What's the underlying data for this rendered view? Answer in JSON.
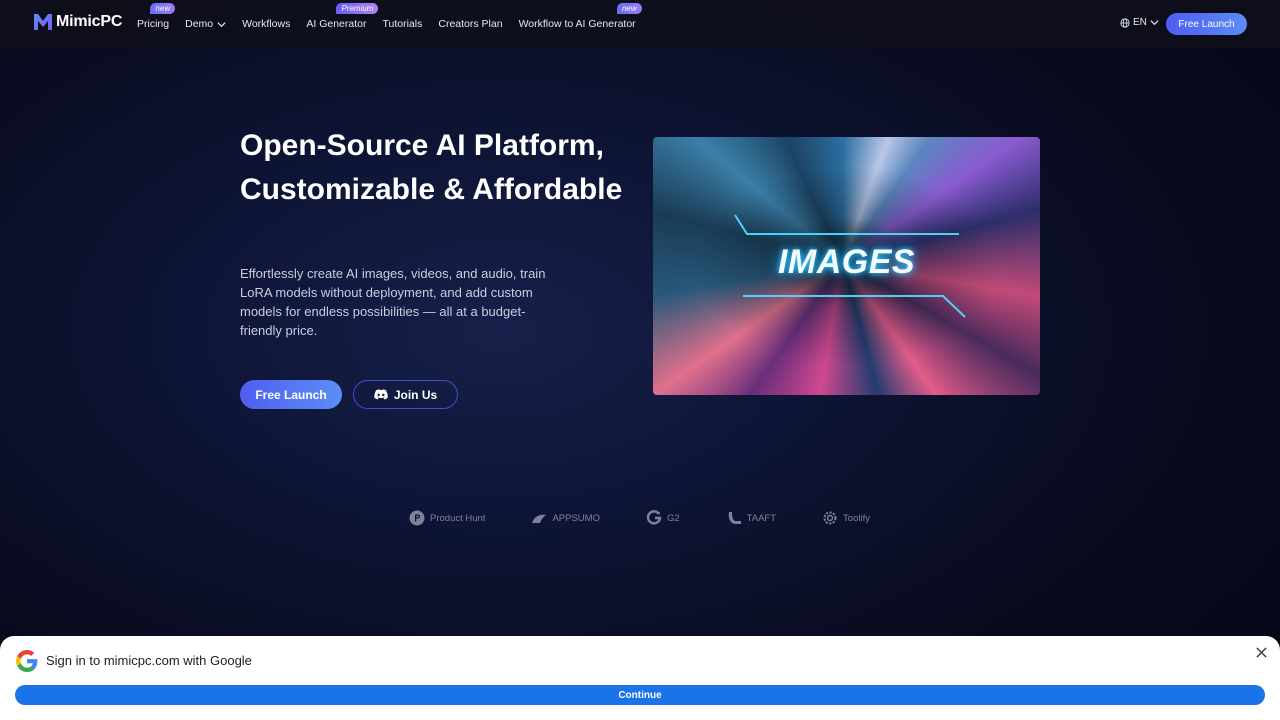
{
  "nav": {
    "logo_text": "MimicPC",
    "items": [
      {
        "label": "Pricing",
        "badge": "new"
      },
      {
        "label": "Demo",
        "badge": ""
      },
      {
        "label": "Workflows",
        "badge": ""
      },
      {
        "label": "AI Generator",
        "badge": "Premium"
      },
      {
        "label": "Tutorials",
        "badge": ""
      },
      {
        "label": "Creators Plan",
        "badge": ""
      },
      {
        "label": "Workflow to AI Generator",
        "badge": "new"
      }
    ],
    "language": "EN",
    "launch_label": "Free Launch"
  },
  "hero": {
    "title": "Open-Source AI Platform, Customizable & Affordable",
    "description": "Effortlessly create AI images, videos, and audio, train LoRA models without deployment, and add custom models for endless possibilities — all at a budget-friendly price.",
    "primary_button": "Free Launch",
    "secondary_button": "Join Us",
    "media_label": "IMAGES"
  },
  "partners": [
    {
      "name": "Product Hunt",
      "icon": "product-hunt-icon"
    },
    {
      "name": "APPSUMO",
      "icon": "appsumo-icon"
    },
    {
      "name": "G2",
      "icon": "g2-icon"
    },
    {
      "name": "TAAFT",
      "icon": "taaft-icon"
    },
    {
      "name": "Toolify",
      "icon": "toolify-icon"
    }
  ],
  "google_signin": {
    "title": "Sign in to mimicpc.com with Google",
    "continue_label": "Continue"
  },
  "colors": {
    "accent": "#4f5df2",
    "google_blue": "#1a73e8",
    "background": "#0d1333"
  }
}
